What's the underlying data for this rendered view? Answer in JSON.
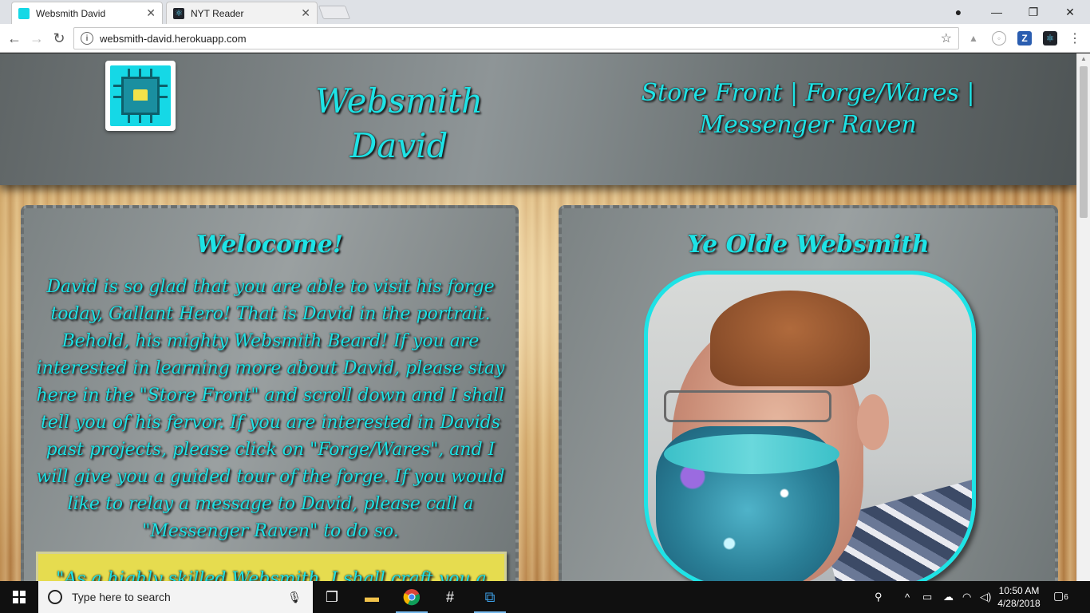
{
  "browser": {
    "tabs": [
      {
        "title": "Websmith David",
        "active": true,
        "favicon": "chip-icon"
      },
      {
        "title": "NYT Reader",
        "active": false,
        "favicon": "react-icon"
      }
    ],
    "url": "websmith-david.herokuapp.com",
    "extensions": [
      "drive-icon",
      "extension-circle-icon",
      "zotero-icon",
      "react-devtools-icon"
    ]
  },
  "site": {
    "title_line1": "Websmith",
    "title_line2": "David",
    "nav": {
      "store_front": "Store Front",
      "separator": "|",
      "forge_wares": "Forge/Wares",
      "messenger_raven": "Messenger Raven"
    },
    "welcome": {
      "heading": "Welocome!",
      "body": "David is so glad that you are able to visit his forge today, Gallant Hero! That is David in the portrait. Behold, his mighty Websmith Beard! If you are interested in learning more about David, please stay here in the \"Store Front\" and scroll down and I shall tell you of his fervor. If you are interested in Davids past projects, please click on \"Forge/Wares\", and I will give you a guided tour of the forge. If you would like to relay a message to David, please call a \"Messenger Raven\" to do so.",
      "quote": "\"As a highly skilled Websmith, I shall craft you a"
    },
    "portrait": {
      "heading": "Ye Olde Websmith"
    },
    "colors": {
      "accent": "#1ee3e6",
      "header_bg": "#7c8384",
      "quote_bg": "#e6dc4f"
    }
  },
  "taskbar": {
    "search_placeholder": "Type here to search",
    "apps": [
      "task-view-icon",
      "file-explorer-icon",
      "chrome-icon",
      "slack-icon",
      "vscode-icon"
    ],
    "time": "10:50 AM",
    "date": "4/28/2018",
    "notifications": "6"
  }
}
